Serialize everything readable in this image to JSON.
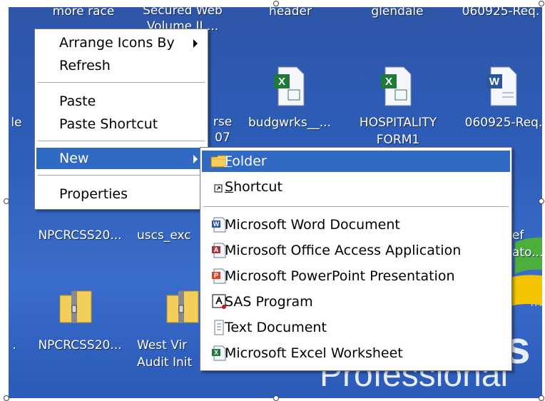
{
  "desktop": {
    "icons": [
      {
        "label": "more race",
        "icon": "file-icon"
      },
      {
        "label": "Secured Web Volume II ...",
        "icon": "file-icon"
      },
      {
        "label": "header",
        "icon": "file-icon"
      },
      {
        "label": "glendale",
        "icon": "file-icon"
      },
      {
        "label": "060925-Req.",
        "icon": "file-icon"
      },
      {
        "label": "le",
        "icon": "file-icon"
      },
      {
        "label": "rse 07",
        "icon": "file-icon"
      },
      {
        "label": "budgwrks__...",
        "icon": "excel-file-icon"
      },
      {
        "label": "HOSPITALITY FORM1",
        "icon": "excel-file-icon"
      },
      {
        "label": "060925-Req.",
        "icon": "word-file-icon"
      },
      {
        "label": "NPCRCSS20...",
        "icon": "file-icon"
      },
      {
        "label": "uscs_exc",
        "icon": "file-icon"
      },
      {
        "label": "ef ato...",
        "icon": "file-icon"
      },
      {
        "label": "NPCRCSS20...",
        "icon": "zip-folder-icon"
      },
      {
        "label": "West Vir Audit Init",
        "icon": "zip-folder-icon"
      },
      {
        "label": ".",
        "icon": "file-icon"
      }
    ],
    "wallpaper_text": "Professional",
    "wallpaper_badge": "TM",
    "wallpaper_letters": "s"
  },
  "context_menu": {
    "items": [
      {
        "label": "Arrange Icons By",
        "submenu": true
      },
      {
        "label": "Refresh"
      },
      {
        "label": "Paste"
      },
      {
        "label": "Paste Shortcut"
      },
      {
        "label": "New",
        "submenu": true,
        "selected": true
      },
      {
        "label": "Properties"
      }
    ]
  },
  "submenu_new": {
    "items": [
      {
        "label": "Folder",
        "icon": "folder-icon",
        "selected": true,
        "accel": "F",
        "rest": "older"
      },
      {
        "label": "Shortcut",
        "icon": "shortcut-icon",
        "accel": "S",
        "rest": "hortcut"
      },
      {
        "label": "Microsoft Word Document",
        "icon": "word-document-icon"
      },
      {
        "label": "Microsoft Office Access Application",
        "icon": "access-document-icon"
      },
      {
        "label": "Microsoft PowerPoint Presentation",
        "icon": "powerpoint-document-icon"
      },
      {
        "label": "SAS Program",
        "icon": "sas-program-icon"
      },
      {
        "label": "Text Document",
        "icon": "text-document-icon"
      },
      {
        "label": "Microsoft Excel Worksheet",
        "icon": "excel-worksheet-icon"
      }
    ]
  },
  "colors": {
    "desktop": "#2f5fb8",
    "highlight": "#316ac5",
    "menu_bg": "#ffffff"
  }
}
